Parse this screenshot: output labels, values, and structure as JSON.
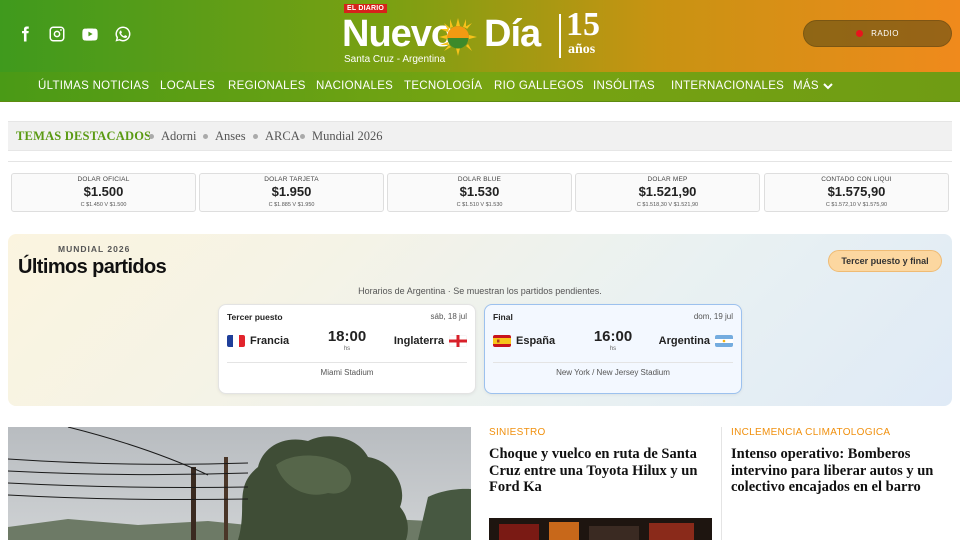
{
  "header": {
    "logo": {
      "eldiario": "EL DIARIO",
      "name_left": "Nuevo",
      "name_right": "Día",
      "place": "Santa Cruz - Argentina",
      "anniversary_number": "15",
      "anniversary_word": "años"
    },
    "social": [
      "facebook-icon",
      "instagram-icon",
      "youtube-icon",
      "whatsapp-icon"
    ],
    "radio_label": "RADIO"
  },
  "nav": {
    "items": [
      "ÚLTIMAS NOTICIAS",
      "LOCALES",
      "REGIONALES",
      "NACIONALES",
      "TECNOLOGÍA",
      "RIO GALLEGOS",
      "INSÓLITAS",
      "INTERNACIONALES",
      "MÁS"
    ]
  },
  "topics": {
    "heading": "TEMAS DESTACADOS",
    "tags": [
      "Adorni",
      "Anses",
      "ARCA",
      "Mundial 2026"
    ]
  },
  "rates": [
    {
      "name": "DOLAR OFICIAL",
      "value": "$1.500",
      "cv": "C $1.450  V $1.500"
    },
    {
      "name": "DOLAR TARJETA",
      "value": "$1.950",
      "cv": "C $1.885  V $1.950"
    },
    {
      "name": "DOLAR BLUE",
      "value": "$1.530",
      "cv": "C $1.510  V $1.530"
    },
    {
      "name": "DOLAR MEP",
      "value": "$1.521,90",
      "cv": "C $1.518,30  V $1.521,90"
    },
    {
      "name": "CONTADO CON LIQUI",
      "value": "$1.575,90",
      "cv": "C $1.572,10  V $1.575,90"
    }
  ],
  "mundial": {
    "label": "MUNDIAL 2026",
    "title": "Últimos partidos",
    "pill": "Tercer puesto y final",
    "note": "Horarios de Argentina · Se muestran los partidos pendientes.",
    "matches": [
      {
        "phase": "Tercer puesto",
        "date": "sáb, 18 jul",
        "home": "Francia",
        "away": "Inglaterra",
        "time": "18:00",
        "unit": "hs",
        "stadium": "Miami Stadium"
      },
      {
        "phase": "Final",
        "date": "dom, 19 jul",
        "home": "España",
        "away": "Argentina",
        "time": "16:00",
        "unit": "hs",
        "stadium": "New York / New Jersey Stadium"
      }
    ]
  },
  "articles": [
    {
      "category": "SINIESTRO",
      "headline": "Choque y vuelco en ruta de Santa Cruz entre una Toyota Hilux y un Ford Ka"
    },
    {
      "category": "INCLEMENCIA CLIMATOLOGICA",
      "headline": "Intenso operativo: Bomberos intervino para liberar autos y un colectivo encajados en el barro"
    }
  ],
  "colors": {
    "brand_green": "#5a9a12",
    "accent_orange": "#f0900e",
    "radio_dot": "#e8141c"
  }
}
